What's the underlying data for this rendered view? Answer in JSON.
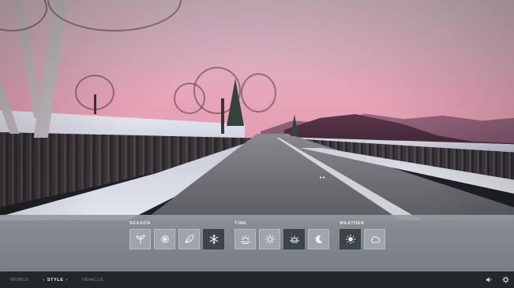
{
  "groups": [
    {
      "label": "SEASON",
      "options": [
        {
          "icon": "sprout-icon",
          "selected": false
        },
        {
          "icon": "sun-icon",
          "selected": false
        },
        {
          "icon": "leaf-icon",
          "selected": false
        },
        {
          "icon": "snowflake-icon",
          "selected": true
        }
      ]
    },
    {
      "label": "TIME",
      "options": [
        {
          "icon": "sunrise-icon",
          "selected": false
        },
        {
          "icon": "sun-icon",
          "selected": false
        },
        {
          "icon": "sunset-icon",
          "selected": true
        },
        {
          "icon": "moon-icon",
          "selected": false
        }
      ]
    },
    {
      "label": "WEATHER",
      "options": [
        {
          "icon": "sun-icon",
          "selected": true
        },
        {
          "icon": "cloud-icon",
          "selected": false
        }
      ]
    }
  ],
  "nav": {
    "tabs": [
      {
        "label": "WORLD",
        "active": false
      },
      {
        "label": "STYLE",
        "active": true,
        "arrow_left": "‹",
        "arrow_right": "›"
      },
      {
        "label": "VEHICLE",
        "active": false
      }
    ]
  },
  "colors": {
    "selected": "#3b4446",
    "panel": "#8f949a",
    "bar": "#23272a"
  }
}
